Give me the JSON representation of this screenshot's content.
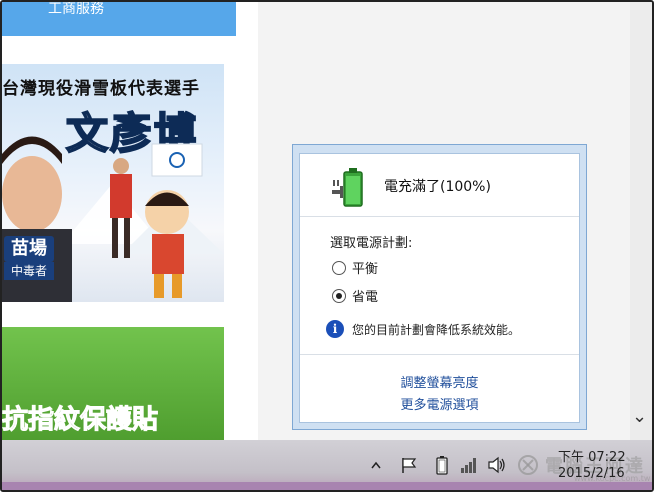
{
  "web": {
    "top_bar_text": "工商服務",
    "banner_title_line1": "台灣現役滑雪板代表選手",
    "banner_title_line2": "文彥博",
    "banner_tag_1": "苗場",
    "banner_tag_2": "中毒者",
    "green_ad_text": "抗指紋保護貼"
  },
  "power_popup": {
    "battery_status": "電充滿了(100%)",
    "plan_label": "選取電源計劃:",
    "plans": [
      {
        "label": "平衡",
        "selected": false
      },
      {
        "label": "省電",
        "selected": true
      }
    ],
    "info_text": "您的目前計劃會降低系統效能。",
    "link_adjust_brightness": "調整螢幕亮度",
    "link_more_options": "更多電源選項"
  },
  "taskbar": {
    "time": "下午 07:22",
    "date": "2015/2/16",
    "watermark": "電腦王阿達",
    "watermark_sub": "www.kocpc.com.tw"
  },
  "icons": {
    "tray_overflow": "chevron-up-icon",
    "flag": "action-center-flag-icon",
    "battery": "battery-icon",
    "network": "signal-bars-icon",
    "volume": "speaker-icon",
    "scroll": "chevron-down-icon"
  },
  "colors": {
    "blue_bar": "#56a7ea",
    "popup_frame": "#cfe0f2",
    "link": "#1f4e9b",
    "info_icon": "#1b4fb8",
    "taskbar": "#c4c0c8"
  }
}
